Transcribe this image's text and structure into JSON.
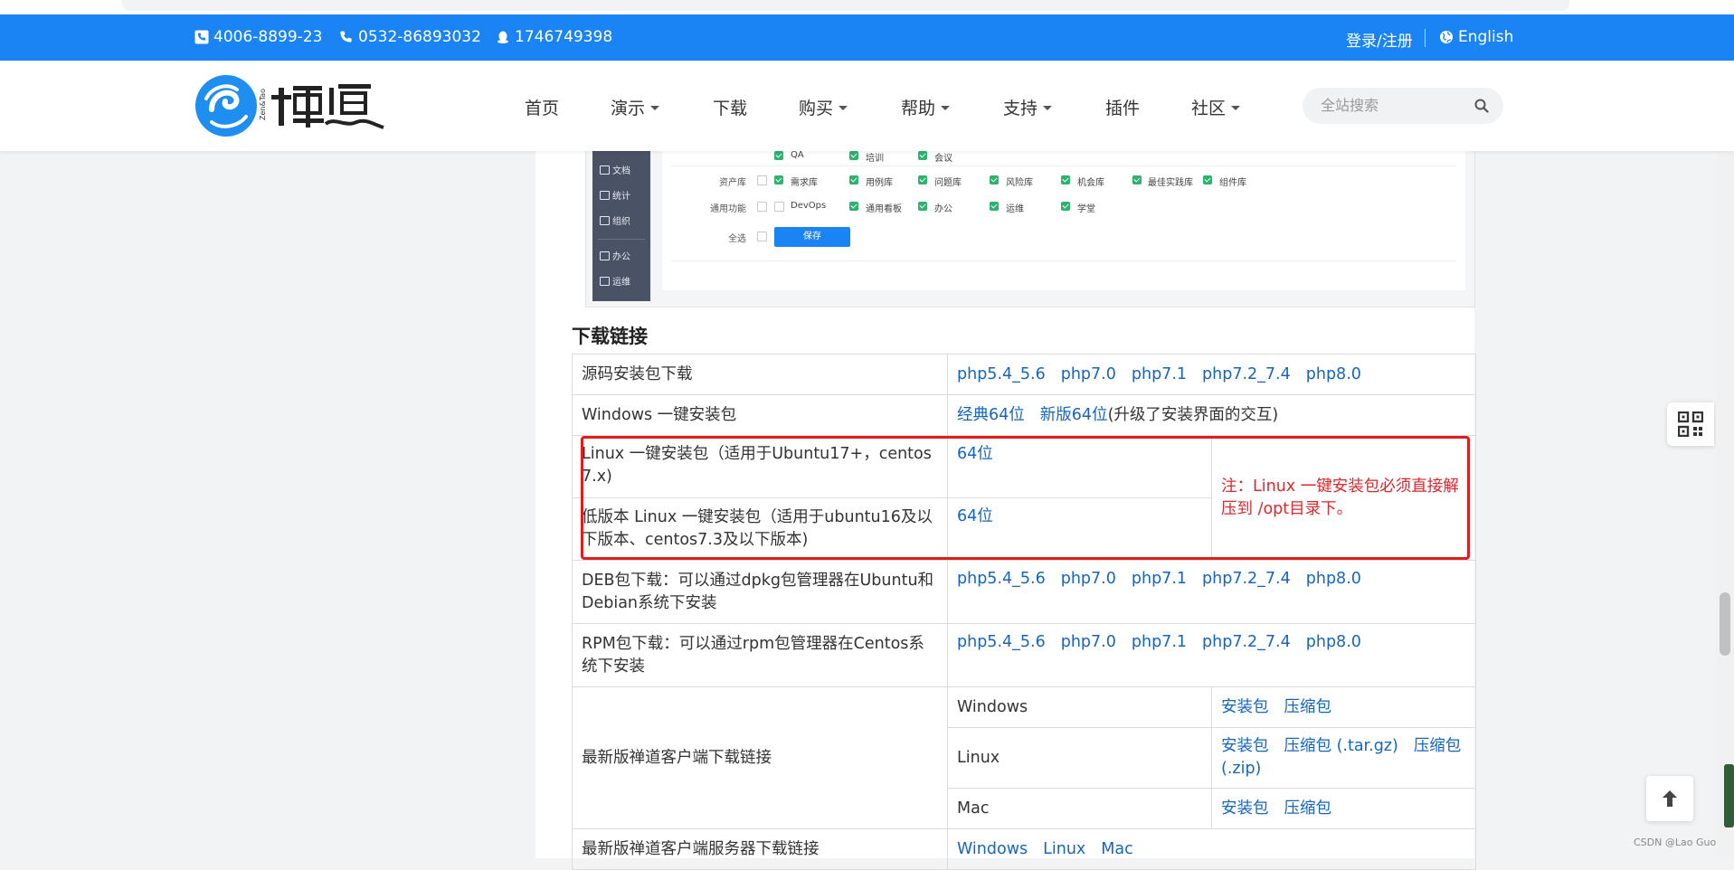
{
  "topbar": {
    "phone1": "4006-8899-23",
    "phone2": "0532-86893032",
    "qq": "1746749398",
    "login": "登录/注册",
    "language": "English"
  },
  "nav": {
    "items": [
      {
        "label": "首页",
        "dropdown": false
      },
      {
        "label": "演示",
        "dropdown": true
      },
      {
        "label": "下载",
        "dropdown": false
      },
      {
        "label": "购买",
        "dropdown": true
      },
      {
        "label": "帮助",
        "dropdown": true
      },
      {
        "label": "支持",
        "dropdown": true
      },
      {
        "label": "插件",
        "dropdown": false
      },
      {
        "label": "社区",
        "dropdown": true
      }
    ],
    "search_placeholder": "全站搜索"
  },
  "screenshot": {
    "sidebar": [
      "文档",
      "统计",
      "组织",
      "办公",
      "运维"
    ],
    "rows": [
      {
        "label": "资产库",
        "items": [
          "需求库",
          "用例库",
          "问题库",
          "风险库",
          "机会库",
          "最佳实践库",
          "组件库"
        ]
      },
      {
        "label": "通用功能",
        "items": [
          "DevOps",
          "通用看板",
          "办公",
          "运维",
          "学堂"
        ]
      },
      {
        "label": "全选",
        "items": []
      }
    ],
    "top_items": [
      "QA",
      "培训",
      "会议"
    ],
    "save_label": "保存"
  },
  "section_title": "下载链接",
  "table": {
    "source": {
      "label": "源码安装包下载",
      "links": [
        "php5.4_5.6",
        "php7.0",
        "php7.1",
        "php7.2_7.4",
        "php8.0"
      ]
    },
    "windows": {
      "label": "Windows 一键安装包",
      "links": [
        "经典64位",
        "新版64位"
      ],
      "suffix": "(升级了安装界面的交互)"
    },
    "linux": {
      "label": "Linux 一键安装包（适用于Ubuntu17+，centos7.x)",
      "link": "64位"
    },
    "linux_old": {
      "label": "低版本 Linux 一键安装包（适用于ubuntu16及以下版本、centos7.3及以下版本)",
      "link": "64位"
    },
    "linux_note": "注：Linux 一键安装包必须直接解压到 /opt目录下。",
    "deb": {
      "label": "DEB包下载：可以通过dpkg包管理器在Ubuntu和Debian系统下安装",
      "links": [
        "php5.4_5.6",
        "php7.0",
        "php7.1",
        "php7.2_7.4",
        "php8.0"
      ]
    },
    "rpm": {
      "label": "RPM包下载：可以通过rpm包管理器在Centos系统下安装",
      "links": [
        "php5.4_5.6",
        "php7.0",
        "php7.1",
        "php7.2_7.4",
        "php8.0"
      ]
    },
    "client": {
      "label": "最新版禅道客户端下载链接",
      "rows": [
        {
          "os": "Windows",
          "links": [
            "安装包",
            "压缩包"
          ]
        },
        {
          "os": "Linux",
          "links": [
            "安装包",
            "压缩包 (.tar.gz)",
            "压缩包 (.zip)"
          ]
        },
        {
          "os": "Mac",
          "links": [
            "安装包",
            "压缩包"
          ]
        }
      ]
    },
    "server": {
      "label": "最新版禅道客户端服务器下载链接",
      "links": [
        "Windows",
        "Linux",
        "Mac"
      ]
    }
  },
  "watermark": "CSDN @Lao Guo"
}
